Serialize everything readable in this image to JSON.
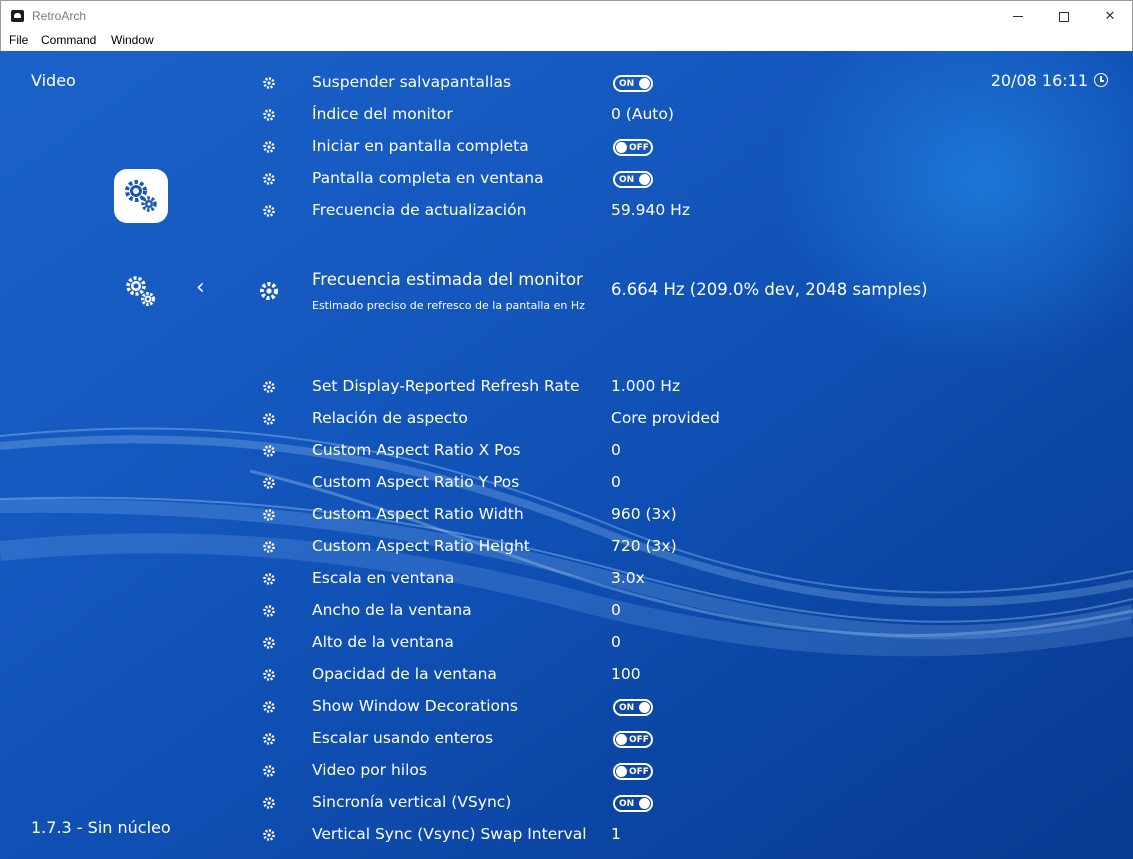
{
  "window": {
    "title": "RetroArch",
    "menu": [
      "File",
      "Command",
      "Window"
    ]
  },
  "header": {
    "section": "Video",
    "datetime": "20/08 16:11"
  },
  "footer": {
    "version": "1.7.3 - Sin núcleo"
  },
  "colors": {
    "background": "#1559c0",
    "text": "#ffffff"
  },
  "items_top": [
    {
      "label": "Suspender salvapantallas",
      "type": "toggle",
      "value": "ON"
    },
    {
      "label": "Índice del monitor",
      "type": "text",
      "value": "0 (Auto)"
    },
    {
      "label": "Iniciar en pantalla completa",
      "type": "toggle",
      "value": "OFF"
    },
    {
      "label": "Pantalla completa en ventana",
      "type": "toggle",
      "value": "ON"
    },
    {
      "label": "Frecuencia de actualización",
      "type": "text",
      "value": "59.940 Hz"
    }
  ],
  "selected": {
    "label": "Frecuencia estimada del monitor",
    "sublabel": "Estimado preciso de refresco de la pantalla en Hz",
    "value": "6.664 Hz (209.0% dev, 2048 samples)"
  },
  "items_bottom": [
    {
      "label": "Set Display-Reported Refresh Rate",
      "type": "text",
      "value": "1.000 Hz"
    },
    {
      "label": "Relación de aspecto",
      "type": "text",
      "value": "Core provided"
    },
    {
      "label": "Custom Aspect Ratio X Pos",
      "type": "text",
      "value": "0"
    },
    {
      "label": "Custom Aspect Ratio Y Pos",
      "type": "text",
      "value": "0"
    },
    {
      "label": "Custom Aspect Ratio Width",
      "type": "text",
      "value": "960 (3x)"
    },
    {
      "label": "Custom Aspect Ratio Height",
      "type": "text",
      "value": "720 (3x)"
    },
    {
      "label": "Escala en ventana",
      "type": "text",
      "value": "3.0x"
    },
    {
      "label": "Ancho de la ventana",
      "type": "text",
      "value": "0"
    },
    {
      "label": "Alto de la ventana",
      "type": "text",
      "value": "0"
    },
    {
      "label": "Opacidad de la ventana",
      "type": "text",
      "value": "100"
    },
    {
      "label": "Show Window Decorations",
      "type": "toggle",
      "value": "ON"
    },
    {
      "label": "Escalar usando enteros",
      "type": "toggle",
      "value": "OFF"
    },
    {
      "label": "Video por hilos",
      "type": "toggle",
      "value": "OFF"
    },
    {
      "label": "Sincronía vertical (VSync)",
      "type": "toggle",
      "value": "ON"
    },
    {
      "label": "Vertical Sync (Vsync) Swap Interval",
      "type": "text",
      "value": "1"
    }
  ]
}
